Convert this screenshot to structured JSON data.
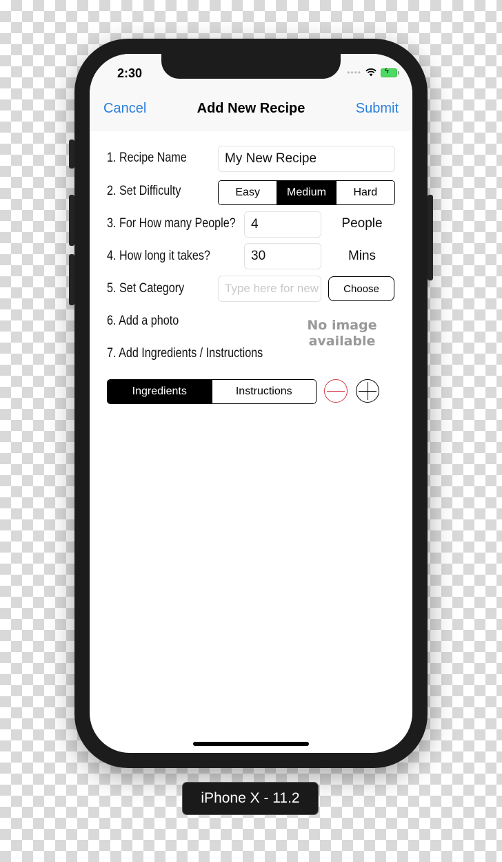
{
  "status_bar": {
    "time": "2:30",
    "signal_icon": "signal-dots-icon",
    "wifi_icon": "wifi-icon",
    "battery_icon": "battery-charging-icon",
    "battery_color": "#4cd964"
  },
  "nav": {
    "cancel_label": "Cancel",
    "title": "Add New Recipe",
    "submit_label": "Submit",
    "accent_color": "#2a7fdf"
  },
  "form": {
    "recipe_name": {
      "label": "1. Recipe Name",
      "value": "My New Recipe"
    },
    "difficulty": {
      "label": "2. Set Difficulty",
      "options": [
        "Easy",
        "Medium",
        "Hard"
      ],
      "selected": "Medium"
    },
    "people": {
      "label": "3. For How many People?",
      "value": "4",
      "unit": "People"
    },
    "duration": {
      "label": "4. How long it takes?",
      "value": "30",
      "unit": "Mins"
    },
    "category": {
      "label": "5. Set Category",
      "placeholder": "Type here for new",
      "choose_label": "Choose"
    },
    "photo": {
      "label": "6. Add a photo",
      "no_image_line1": "No image",
      "no_image_line2": "available"
    },
    "ingredients": {
      "label": "7. Add Ingredients / Instructions",
      "tabs": [
        "Ingredients",
        "Instructions"
      ],
      "selected": "Ingredients",
      "remove_icon": "minus-circle-icon",
      "add_icon": "plus-circle-icon"
    }
  },
  "device_label": "iPhone X - 11.2"
}
